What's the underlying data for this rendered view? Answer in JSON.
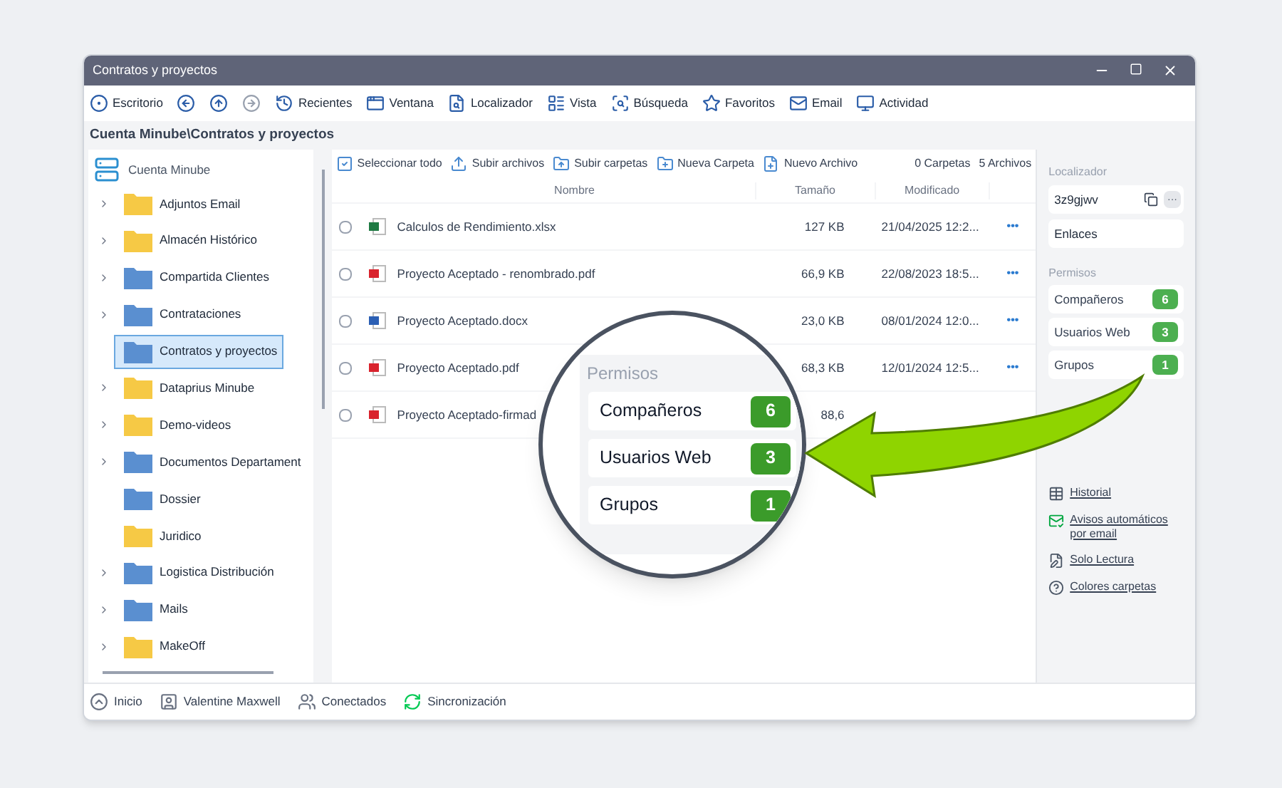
{
  "window": {
    "title": "Contratos y proyectos"
  },
  "toolbar": [
    {
      "kind": "desktop",
      "label": "Escritorio",
      "disabled": false
    },
    {
      "kind": "back",
      "disabled": false
    },
    {
      "kind": "up",
      "disabled": false
    },
    {
      "kind": "forward",
      "disabled": true
    },
    {
      "kind": "recent",
      "label": "Recientes",
      "disabled": false
    },
    {
      "kind": "window",
      "label": "Ventana",
      "disabled": false
    },
    {
      "kind": "locator",
      "label": "Localizador",
      "disabled": false
    },
    {
      "kind": "view",
      "label": "Vista",
      "disabled": false
    },
    {
      "kind": "search",
      "label": "Búsqueda",
      "disabled": false
    },
    {
      "kind": "favorites",
      "label": "Favoritos",
      "disabled": false
    },
    {
      "kind": "email",
      "label": "Email",
      "disabled": false
    },
    {
      "kind": "activity",
      "label": "Actividad",
      "disabled": false
    }
  ],
  "breadcrumb": "Cuenta Minube\\Contratos y proyectos",
  "tree": {
    "root": "Cuenta Minube",
    "items": [
      {
        "name": "Adjuntos Email",
        "color": "#f6c945",
        "expandable": true,
        "selected": false
      },
      {
        "name": "Almacén Histórico",
        "color": "#f6c945",
        "expandable": true,
        "selected": false
      },
      {
        "name": "Compartida Clientes",
        "color": "#5b8fd0",
        "expandable": true,
        "selected": false
      },
      {
        "name": "Contrataciones",
        "color": "#5b8fd0",
        "expandable": true,
        "selected": false
      },
      {
        "name": "Contratos y proyectos",
        "color": "#5b8fd0",
        "expandable": false,
        "selected": true
      },
      {
        "name": "Dataprius Minube",
        "color": "#f6c945",
        "expandable": true,
        "selected": false
      },
      {
        "name": "Demo-videos",
        "color": "#f6c945",
        "expandable": true,
        "selected": false
      },
      {
        "name": "Documentos Departament",
        "color": "#5b8fd0",
        "expandable": true,
        "selected": false
      },
      {
        "name": "Dossier",
        "color": "#5b8fd0",
        "expandable": false,
        "selected": false
      },
      {
        "name": "Juridico",
        "color": "#f6c945",
        "expandable": false,
        "selected": false
      },
      {
        "name": "Logistica Distribución",
        "color": "#5b8fd0",
        "expandable": true,
        "selected": false
      },
      {
        "name": "Mails",
        "color": "#5b8fd0",
        "expandable": true,
        "selected": false
      },
      {
        "name": "MakeOff",
        "color": "#f6c945",
        "expandable": true,
        "selected": false
      }
    ]
  },
  "actions": [
    {
      "kind": "select",
      "label": "Seleccionar todo"
    },
    {
      "kind": "upload",
      "label": "Subir archivos"
    },
    {
      "kind": "upload-folder",
      "label": "Subir carpetas"
    },
    {
      "kind": "new-folder",
      "label": "Nueva Carpeta"
    },
    {
      "kind": "new-file",
      "label": "Nuevo Archivo"
    }
  ],
  "counts": {
    "folders": "0 Carpetas",
    "files": "5 Archivos"
  },
  "table": {
    "columns": [
      "Nombre",
      "Tamaño",
      "Modificado"
    ],
    "rows": [
      {
        "kind": "xlsx",
        "name": "Calculos de Rendimiento.xlsx",
        "size": "127 KB",
        "modified": "21/04/2025 12:2...",
        "more": "•••",
        "checked": false
      },
      {
        "kind": "pdf",
        "name": "Proyecto Aceptado - renombrado.pdf",
        "size": "66,9 KB",
        "modified": "22/08/2023 18:5...",
        "more": "•••",
        "checked": false
      },
      {
        "kind": "docx",
        "name": "Proyecto Aceptado.docx",
        "size": "23,0 KB",
        "modified": "08/01/2024 12:0...",
        "more": "•••",
        "checked": false
      },
      {
        "kind": "pdf",
        "name": "Proyecto Aceptado.pdf",
        "size": "68,3 KB",
        "modified": "12/01/2024 12:5...",
        "more": "•••",
        "checked": false
      },
      {
        "kind": "pdf",
        "name": "Proyecto Aceptado-firmad",
        "size": "88,6",
        "checked": false
      }
    ]
  },
  "side": {
    "locator_label": "Localizador",
    "locator": "3z9gjwv",
    "more": "···",
    "links_label": "Enlaces",
    "permissions_label": "Permisos",
    "permissions": [
      {
        "label": "Compañeros",
        "count": "6"
      },
      {
        "label": "Usuarios Web",
        "count": "3"
      },
      {
        "label": "Grupos",
        "count": "1"
      }
    ],
    "links": [
      {
        "kind": "history",
        "label": "Historial"
      },
      {
        "kind": "alerts",
        "label": "Avisos automáticos por email"
      },
      {
        "kind": "readonly",
        "label": "Solo Lectura"
      },
      {
        "kind": "help",
        "label": "Colores carpetas"
      }
    ]
  },
  "status_bar": [
    {
      "kind": "home",
      "label": "Inicio"
    },
    {
      "kind": "user",
      "label": "Valentine Maxwell"
    },
    {
      "kind": "connected",
      "label": "Conectados"
    },
    {
      "kind": "sync",
      "label": "Sincronización"
    }
  ],
  "magnifier": {
    "title": "Permisos",
    "permissions": [
      {
        "label": "Compañeros",
        "count": "6"
      },
      {
        "label": "Usuarios Web",
        "count": "3"
      },
      {
        "label": "Grupos",
        "count": "1"
      }
    ]
  }
}
